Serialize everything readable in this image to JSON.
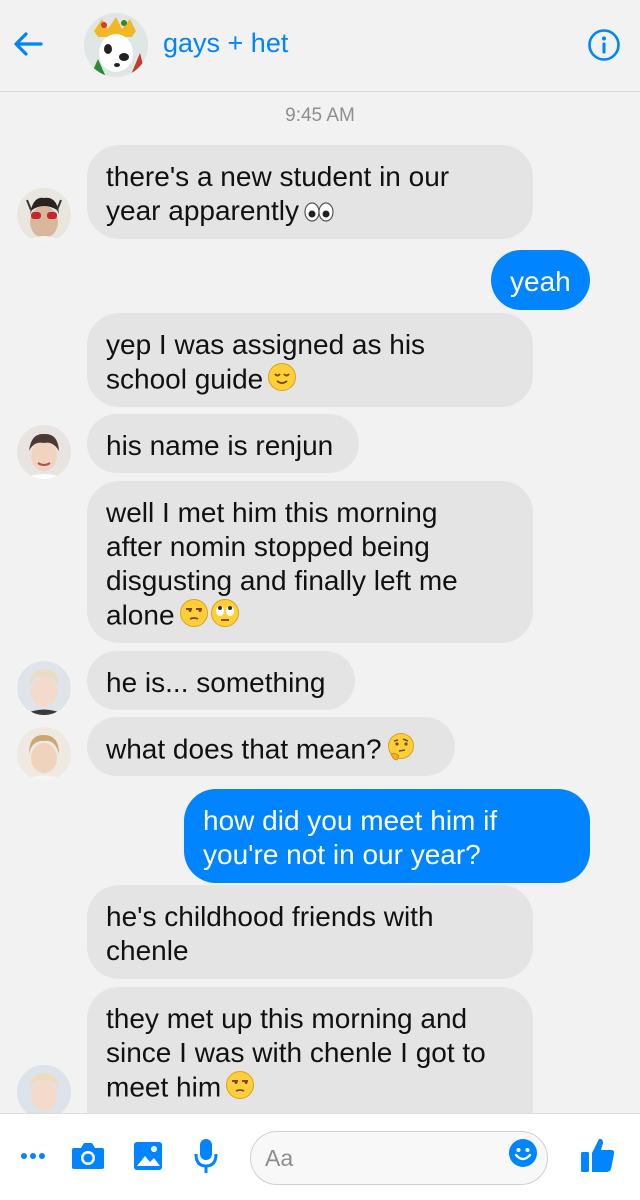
{
  "header": {
    "title": "gays + het",
    "back_icon": "back-arrow-icon",
    "info_icon": "info-icon"
  },
  "timestamp": "9:45 AM",
  "messages": [
    {
      "side": "in",
      "text": "there's a new student in our\nyear apparently",
      "emoji": "eyes"
    },
    {
      "side": "out",
      "text": "yeah"
    },
    {
      "side": "in",
      "text": "yep I was assigned as his\nschool guide",
      "emoji": "relieved"
    },
    {
      "side": "in",
      "text": "his name is renjun"
    },
    {
      "side": "in",
      "text": "well I met him this morning\nafter nomin stopped being\ndisgusting and finally left me\nalone",
      "emoji": "unamused, rolling-eyes"
    },
    {
      "side": "in",
      "text": "he is... something"
    },
    {
      "side": "in",
      "text": "what does that mean?",
      "emoji": "thinking"
    },
    {
      "side": "out",
      "text": "how did you meet him if\nyou're not in our year?"
    },
    {
      "side": "in",
      "text": "he's childhood friends with\nchenle"
    },
    {
      "side": "in",
      "text": "they met up this morning and\nsince I was with chenle I got to\nmeet him",
      "emoji": "unamused"
    }
  ],
  "composer": {
    "placeholder": "Aa",
    "icons": [
      "more-icon",
      "camera-icon",
      "gallery-icon",
      "microphone-icon",
      "emoji-icon",
      "thumbs-up-icon"
    ]
  },
  "colors": {
    "accent": "#0084ff",
    "incoming_bubble": "#e4e4e4",
    "background": "#f2f2f2"
  }
}
